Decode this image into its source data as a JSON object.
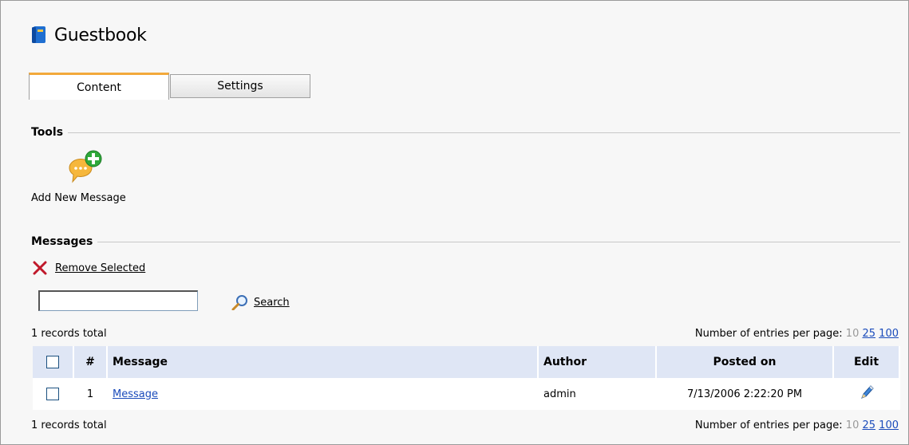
{
  "header": {
    "title": "Guestbook",
    "icon": "book-icon"
  },
  "tabs": [
    {
      "label": "Content",
      "active": true
    },
    {
      "label": "Settings",
      "active": false
    }
  ],
  "tools": {
    "section_label": "Tools",
    "add_new_message_label": "Add New Message",
    "icon": "add-message-icon"
  },
  "messages": {
    "section_label": "Messages",
    "remove_selected_label": "Remove Selected",
    "search_input_value": "",
    "search_label": "Search",
    "records_total_top": "1 records total",
    "records_total_bottom": "1 records total",
    "pager": {
      "label": "Number of entries per page:",
      "options": [
        "10",
        "25",
        "100"
      ],
      "current": "10"
    },
    "columns": {
      "select": "",
      "number": "#",
      "message": "Message",
      "author": "Author",
      "posted_on": "Posted on",
      "edit": "Edit"
    },
    "rows": [
      {
        "number": "1",
        "message": "Message",
        "author": "admin",
        "posted_on": "7/13/2006 2:22:20 PM",
        "checked": false
      }
    ]
  },
  "colors": {
    "tab_accent": "#f2a93b",
    "header_bg": "#dfe6f5",
    "link": "#1a4bbb"
  }
}
